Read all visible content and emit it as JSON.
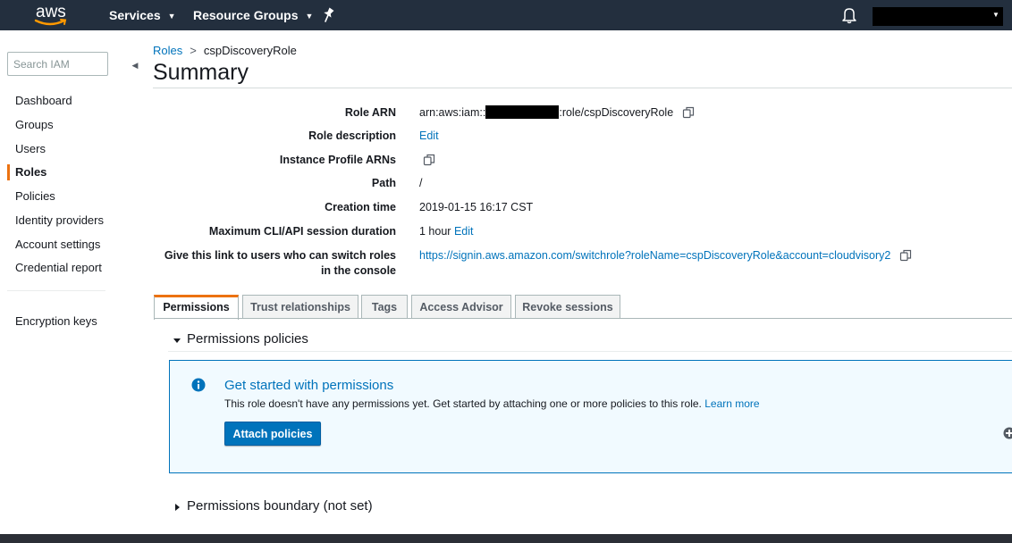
{
  "topnav": {
    "logo_text": "aws",
    "services_label": "Services",
    "resource_groups_label": "Resource Groups"
  },
  "sidebar": {
    "search_placeholder": "Search IAM",
    "items": [
      {
        "label": "Dashboard"
      },
      {
        "label": "Groups"
      },
      {
        "label": "Users"
      },
      {
        "label": "Roles",
        "active": true
      },
      {
        "label": "Policies"
      },
      {
        "label": "Identity providers"
      },
      {
        "label": "Account settings"
      },
      {
        "label": "Credential report"
      },
      {
        "label": "Encryption keys"
      }
    ]
  },
  "breadcrumb": {
    "parent": "Roles",
    "separator": ">",
    "current": "cspDiscoveryRole"
  },
  "page_title": "Summary",
  "summary": {
    "role_arn": {
      "label": "Role ARN",
      "prefix": "arn:aws:iam::",
      "suffix": ":role/cspDiscoveryRole"
    },
    "role_description": {
      "label": "Role description",
      "link": "Edit"
    },
    "instance_profile": {
      "label": "Instance Profile ARNs"
    },
    "path": {
      "label": "Path",
      "value": "/"
    },
    "creation_time": {
      "label": "Creation time",
      "value": "2019-01-15 16:17 CST"
    },
    "max_session": {
      "label": "Maximum CLI/API session duration",
      "value": "1 hour",
      "link": "Edit"
    },
    "switch_link": {
      "label_line1": "Give this link to users who can switch roles",
      "label_line2": "in the console",
      "url": "https://signin.aws.amazon.com/switchrole?roleName=cspDiscoveryRole&account=cloudvisory2"
    }
  },
  "tabs": [
    {
      "label": "Permissions",
      "active": true
    },
    {
      "label": "Trust relationships"
    },
    {
      "label": "Tags"
    },
    {
      "label": "Access Advisor"
    },
    {
      "label": "Revoke sessions"
    }
  ],
  "permissions": {
    "policies_heading": "Permissions policies",
    "info_title": "Get started with permissions",
    "info_text": "This role doesn't have any permissions yet. Get started by attaching one or more policies to this role.",
    "learn_more": "Learn more",
    "attach_button": "Attach policies",
    "boundary_heading": "Permissions boundary (not set)"
  },
  "colors": {
    "nav_bg": "#232f3e",
    "link": "#0073bb",
    "accent": "#ec7211",
    "info_bg": "#f1faff"
  }
}
